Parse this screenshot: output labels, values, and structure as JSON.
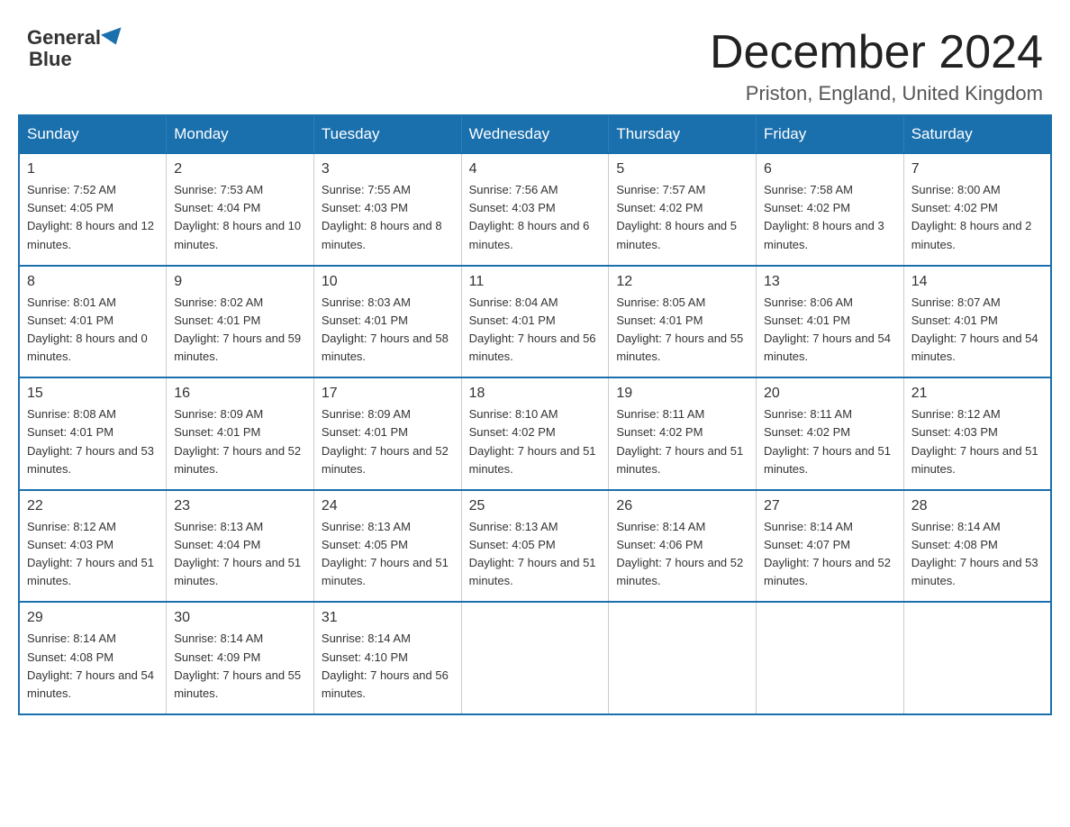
{
  "header": {
    "logo_line1": "General",
    "logo_line2": "Blue",
    "title": "December 2024",
    "subtitle": "Priston, England, United Kingdom"
  },
  "weekdays": [
    "Sunday",
    "Monday",
    "Tuesday",
    "Wednesday",
    "Thursday",
    "Friday",
    "Saturday"
  ],
  "weeks": [
    [
      {
        "day": "1",
        "sunrise": "7:52 AM",
        "sunset": "4:05 PM",
        "daylight": "8 hours and 12 minutes."
      },
      {
        "day": "2",
        "sunrise": "7:53 AM",
        "sunset": "4:04 PM",
        "daylight": "8 hours and 10 minutes."
      },
      {
        "day": "3",
        "sunrise": "7:55 AM",
        "sunset": "4:03 PM",
        "daylight": "8 hours and 8 minutes."
      },
      {
        "day": "4",
        "sunrise": "7:56 AM",
        "sunset": "4:03 PM",
        "daylight": "8 hours and 6 minutes."
      },
      {
        "day": "5",
        "sunrise": "7:57 AM",
        "sunset": "4:02 PM",
        "daylight": "8 hours and 5 minutes."
      },
      {
        "day": "6",
        "sunrise": "7:58 AM",
        "sunset": "4:02 PM",
        "daylight": "8 hours and 3 minutes."
      },
      {
        "day": "7",
        "sunrise": "8:00 AM",
        "sunset": "4:02 PM",
        "daylight": "8 hours and 2 minutes."
      }
    ],
    [
      {
        "day": "8",
        "sunrise": "8:01 AM",
        "sunset": "4:01 PM",
        "daylight": "8 hours and 0 minutes."
      },
      {
        "day": "9",
        "sunrise": "8:02 AM",
        "sunset": "4:01 PM",
        "daylight": "7 hours and 59 minutes."
      },
      {
        "day": "10",
        "sunrise": "8:03 AM",
        "sunset": "4:01 PM",
        "daylight": "7 hours and 58 minutes."
      },
      {
        "day": "11",
        "sunrise": "8:04 AM",
        "sunset": "4:01 PM",
        "daylight": "7 hours and 56 minutes."
      },
      {
        "day": "12",
        "sunrise": "8:05 AM",
        "sunset": "4:01 PM",
        "daylight": "7 hours and 55 minutes."
      },
      {
        "day": "13",
        "sunrise": "8:06 AM",
        "sunset": "4:01 PM",
        "daylight": "7 hours and 54 minutes."
      },
      {
        "day": "14",
        "sunrise": "8:07 AM",
        "sunset": "4:01 PM",
        "daylight": "7 hours and 54 minutes."
      }
    ],
    [
      {
        "day": "15",
        "sunrise": "8:08 AM",
        "sunset": "4:01 PM",
        "daylight": "7 hours and 53 minutes."
      },
      {
        "day": "16",
        "sunrise": "8:09 AM",
        "sunset": "4:01 PM",
        "daylight": "7 hours and 52 minutes."
      },
      {
        "day": "17",
        "sunrise": "8:09 AM",
        "sunset": "4:01 PM",
        "daylight": "7 hours and 52 minutes."
      },
      {
        "day": "18",
        "sunrise": "8:10 AM",
        "sunset": "4:02 PM",
        "daylight": "7 hours and 51 minutes."
      },
      {
        "day": "19",
        "sunrise": "8:11 AM",
        "sunset": "4:02 PM",
        "daylight": "7 hours and 51 minutes."
      },
      {
        "day": "20",
        "sunrise": "8:11 AM",
        "sunset": "4:02 PM",
        "daylight": "7 hours and 51 minutes."
      },
      {
        "day": "21",
        "sunrise": "8:12 AM",
        "sunset": "4:03 PM",
        "daylight": "7 hours and 51 minutes."
      }
    ],
    [
      {
        "day": "22",
        "sunrise": "8:12 AM",
        "sunset": "4:03 PM",
        "daylight": "7 hours and 51 minutes."
      },
      {
        "day": "23",
        "sunrise": "8:13 AM",
        "sunset": "4:04 PM",
        "daylight": "7 hours and 51 minutes."
      },
      {
        "day": "24",
        "sunrise": "8:13 AM",
        "sunset": "4:05 PM",
        "daylight": "7 hours and 51 minutes."
      },
      {
        "day": "25",
        "sunrise": "8:13 AM",
        "sunset": "4:05 PM",
        "daylight": "7 hours and 51 minutes."
      },
      {
        "day": "26",
        "sunrise": "8:14 AM",
        "sunset": "4:06 PM",
        "daylight": "7 hours and 52 minutes."
      },
      {
        "day": "27",
        "sunrise": "8:14 AM",
        "sunset": "4:07 PM",
        "daylight": "7 hours and 52 minutes."
      },
      {
        "day": "28",
        "sunrise": "8:14 AM",
        "sunset": "4:08 PM",
        "daylight": "7 hours and 53 minutes."
      }
    ],
    [
      {
        "day": "29",
        "sunrise": "8:14 AM",
        "sunset": "4:08 PM",
        "daylight": "7 hours and 54 minutes."
      },
      {
        "day": "30",
        "sunrise": "8:14 AM",
        "sunset": "4:09 PM",
        "daylight": "7 hours and 55 minutes."
      },
      {
        "day": "31",
        "sunrise": "8:14 AM",
        "sunset": "4:10 PM",
        "daylight": "7 hours and 56 minutes."
      },
      null,
      null,
      null,
      null
    ]
  ]
}
